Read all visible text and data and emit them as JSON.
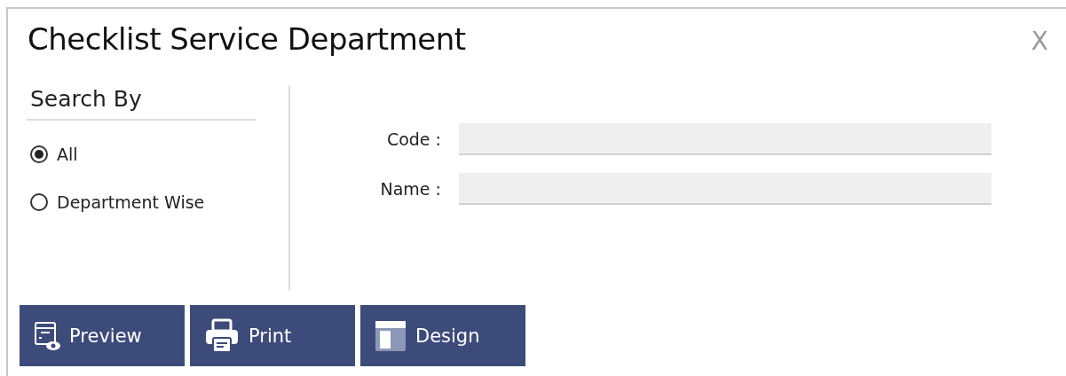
{
  "dialog": {
    "title": "Checklist Service Department",
    "close": "X"
  },
  "search_by": {
    "heading": "Search By",
    "options": [
      {
        "label": "All",
        "selected": true
      },
      {
        "label": "Department Wise",
        "selected": false
      }
    ]
  },
  "fields": [
    {
      "label": "Code :"
    },
    {
      "label": "Name :"
    }
  ],
  "buttons": [
    {
      "label": "Preview",
      "kind": "preview"
    },
    {
      "label": "Print",
      "kind": "print"
    },
    {
      "label": "Design",
      "kind": "design"
    }
  ]
}
